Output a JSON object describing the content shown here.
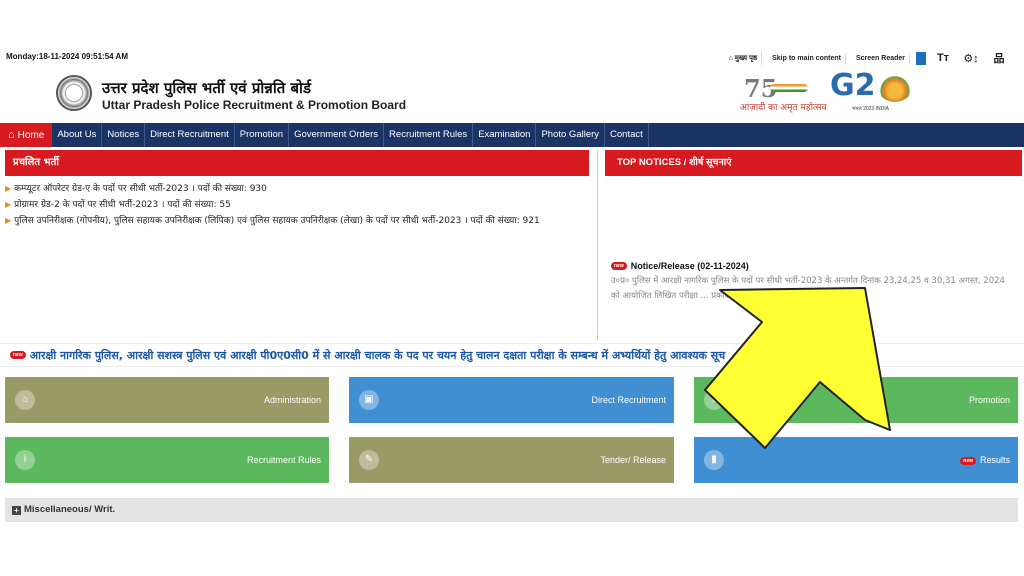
{
  "topbar": {
    "datetime": "Monday:18-11-2024 09:51:54 AM",
    "links": [
      {
        "icon": "home-icon",
        "label": "मुख्य पृष्ठ"
      },
      {
        "label": "Skip to main content"
      },
      {
        "label": "Screen Reader"
      }
    ],
    "tools": {
      "font_size": "Tт",
      "settings": "⚙↕",
      "sitemap": "品"
    },
    "accent_color": "#1d6fb8"
  },
  "header": {
    "title_hindi": "उत्तर प्रदेश पुलिस भर्ती एवं प्रोन्नति बोर्ड",
    "title_english": "Uttar Pradesh Police Recruitment & Promotion Board",
    "azadi_number": "75",
    "azadi_text": "आज़ादी का अमृत महोत्सव",
    "g20_text": "G2",
    "g20_sub": "भारत 2023 INDIA"
  },
  "nav": {
    "items": [
      {
        "label": "Home",
        "icon": "home-icon"
      },
      {
        "label": "About Us"
      },
      {
        "label": "Notices"
      },
      {
        "label": "Direct Recruitment"
      },
      {
        "label": "Promotion"
      },
      {
        "label": "Government Orders"
      },
      {
        "label": "Recruitment Rules"
      },
      {
        "label": "Examination"
      },
      {
        "label": "Photo Gallery"
      },
      {
        "label": "Contact"
      }
    ],
    "colors": {
      "bar": "#1a3466",
      "active": "#d71920"
    }
  },
  "left_panel": {
    "heading": "प्रचलित भर्ती",
    "items": [
      "कम्प्यूटर ऑपरेटर ग्रेड-ए के पदों पर सीधी भर्ती-2023 । पदों की संख्या: 930",
      "प्रोग्रामर ग्रेड-2 के पदों पर सीधी भर्ती-2023 । पदों की संख्या: 55",
      "पुलिस उपनिरीक्षक (गोपनीय), पुलिस सहायक उपनिरीक्षक (लिपिक) एवं पुलिस सहायक उपनिरीक्षक (लेखा) के पदों पर सीधी भर्ती-2023 । पदों की संख्या: 921"
    ]
  },
  "right_panel": {
    "heading": "TOP NOTICES / शीर्ष सूचनाएं",
    "notice": {
      "badge": "new",
      "title": "Notice/Release (02-11-2024)",
      "text": "उ०प्र० पुलिस में आरक्षी नागरिक पुलिस के पदों पर सीधी भर्ती-2023 के अन्तर्गत दिनांक 23,24,25 व 30,31 अगस्त, 2024 को आयोजित लिखित परीक्षा ... प्रकाशन ।"
    }
  },
  "marquee": {
    "badge": "new",
    "text": "आरक्षी नागरिक पुलिस, आरक्षी सशस्त्र पुलिस एवं आरक्षी पी0ए0सी0 में से आरक्षी चालक के पद पर चयन हेतु चालन दक्षता परीक्षा के सम्बन्ध में अभ्यर्थियों हेतु आवश्यक सूच"
  },
  "tiles": [
    {
      "label": "Administration",
      "icon": "home-icon"
    },
    {
      "label": "Direct Recruitment",
      "icon": "id-card-icon"
    },
    {
      "label": "Promotion",
      "icon": "promotion-icon"
    },
    {
      "label": "Recruitment Rules",
      "icon": "person-icon"
    },
    {
      "label": "Tender/ Release",
      "icon": "tag-icon"
    },
    {
      "label": "Results",
      "icon": "bookmark-icon",
      "badge": "new"
    }
  ],
  "tile_colors": {
    "olive": "#999a66",
    "green": "#5cb85c",
    "blue": "#3f8fd2"
  },
  "misc": {
    "label": "Miscellaneous/ Writ."
  },
  "overlay": {
    "arrow_color": "#ffff33"
  }
}
